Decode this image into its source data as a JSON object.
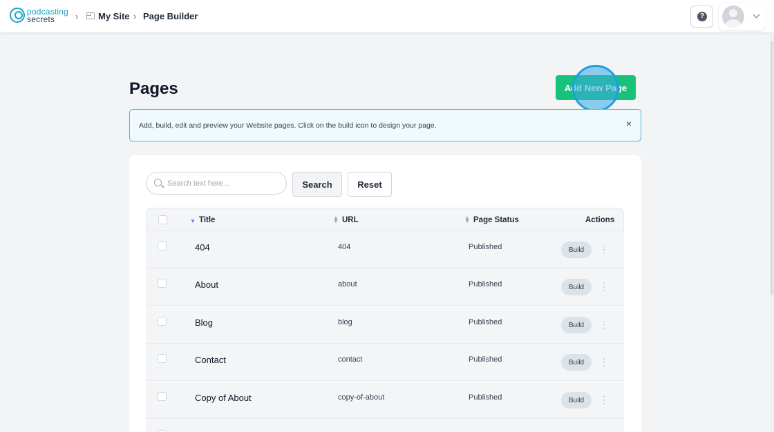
{
  "header": {
    "logo_line1": "podcasting",
    "logo_line2": "secrets",
    "breadcrumb": [
      "My Site",
      "Page Builder"
    ],
    "help_label": "?"
  },
  "page": {
    "title": "Pages",
    "add_button_label": "Add New Page"
  },
  "info": {
    "text": "Add, build, edit and preview your Website pages. Click on the build icon to design your page.",
    "close_label": "×"
  },
  "search": {
    "placeholder": "Search text here...",
    "value": "",
    "search_label": "Search",
    "reset_label": "Reset"
  },
  "table": {
    "headers": [
      "Title",
      "URL",
      "Page Status",
      "Actions"
    ],
    "rows": [
      {
        "title": "404",
        "url": "404",
        "status": "Published",
        "action": "Build"
      },
      {
        "title": "About",
        "url": "about",
        "status": "Published",
        "action": "Build"
      },
      {
        "title": "Blog",
        "url": "blog",
        "status": "Published",
        "action": "Build"
      },
      {
        "title": "Contact",
        "url": "contact",
        "status": "Published",
        "action": "Build"
      },
      {
        "title": "Copy of About",
        "url": "copy-of-about",
        "status": "Published",
        "action": "Build"
      }
    ]
  },
  "colors": {
    "brand": "#1aa3c8",
    "primary_button": "#19c27a",
    "info_border": "#4fb3c9",
    "build_badge": "#dbe3e8"
  }
}
